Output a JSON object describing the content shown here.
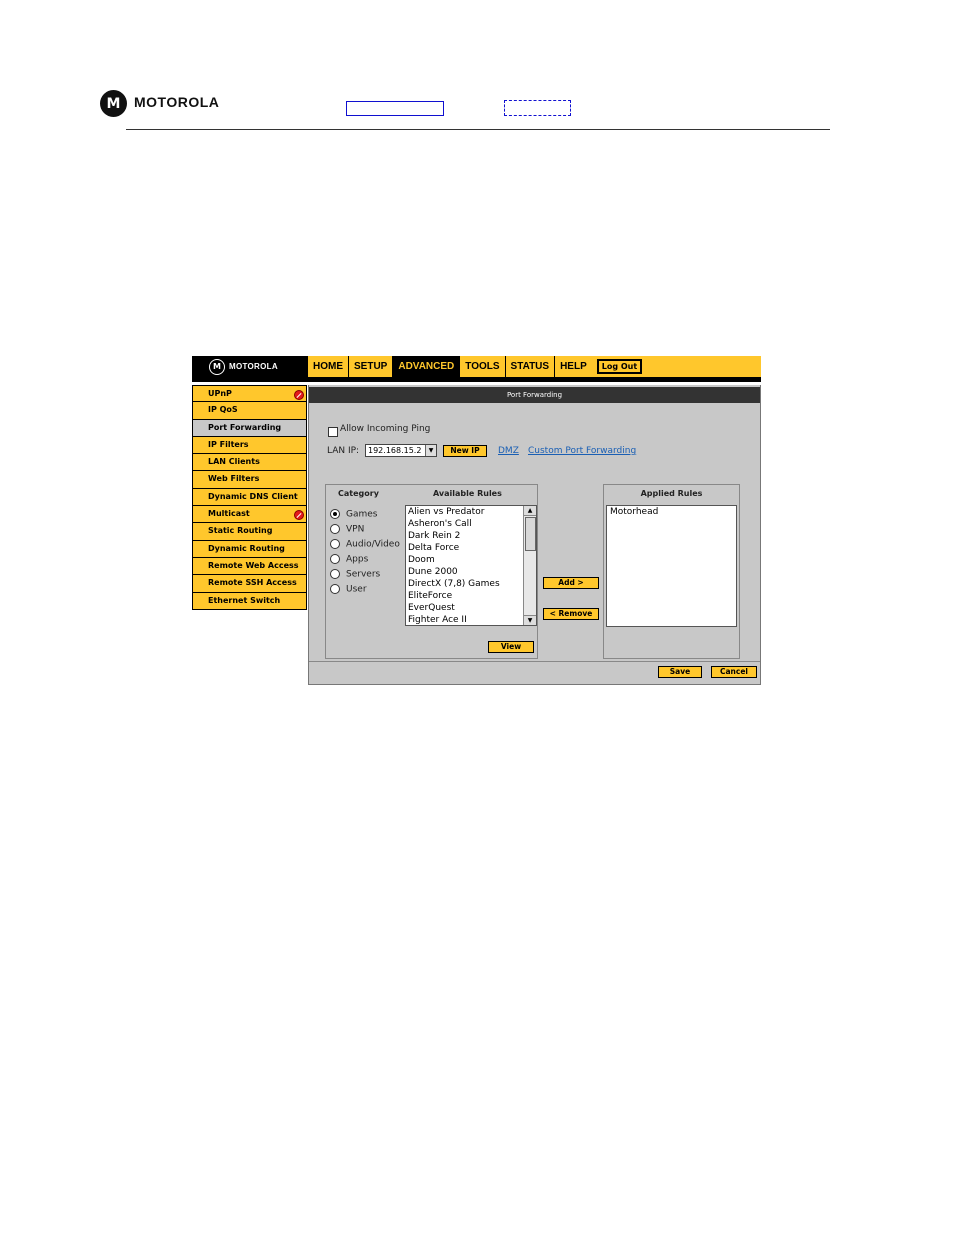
{
  "doc_header": {
    "logo_glyph": "M",
    "brand": "MOTOROLA"
  },
  "app": {
    "logo_glyph": "M",
    "logo_text": "MOTOROLA",
    "nav": [
      "HOME",
      "SETUP",
      "ADVANCED",
      "TOOLS",
      "STATUS",
      "HELP"
    ],
    "nav_active": "ADVANCED",
    "logout_label": "Log Out",
    "sidebar": [
      {
        "label": "UPnP",
        "alert": true
      },
      {
        "label": "IP QoS",
        "alert": false
      },
      {
        "label": "Port Forwarding",
        "alert": false,
        "selected": true
      },
      {
        "label": "IP Filters",
        "alert": false
      },
      {
        "label": "LAN Clients",
        "alert": false
      },
      {
        "label": "Web Filters",
        "alert": false
      },
      {
        "label": "Dynamic DNS Client",
        "alert": false
      },
      {
        "label": "Multicast",
        "alert": true
      },
      {
        "label": "Static Routing",
        "alert": false
      },
      {
        "label": "Dynamic Routing",
        "alert": false
      },
      {
        "label": "Remote Web Access",
        "alert": false
      },
      {
        "label": "Remote SSH Access",
        "alert": false
      },
      {
        "label": "Ethernet Switch",
        "alert": false
      }
    ],
    "page_title": "Port Forwarding",
    "allow_ping_label": "Allow Incoming Ping",
    "allow_ping_checked": false,
    "lan_ip_label": "LAN IP:",
    "lan_ip_value": "192.168.15.2",
    "new_ip_button": "New IP",
    "dmz_link": "DMZ",
    "custom_pf_link": "Custom Port Forwarding",
    "category_header": "Category",
    "available_header": "Available Rules",
    "categories": [
      "Games",
      "VPN",
      "Audio/Video",
      "Apps",
      "Servers",
      "User"
    ],
    "selected_category": "Games",
    "available_rules": [
      "Alien vs Predator",
      "Asheron's Call",
      "Dark Rein 2",
      "Delta Force",
      "Doom",
      "Dune 2000",
      "DirectX (7,8) Games",
      "EliteForce",
      "EverQuest",
      "Fighter Ace II"
    ],
    "view_button": "View",
    "add_button": "Add >",
    "remove_button": "< Remove",
    "applied_header": "Applied Rules",
    "applied_rules": [
      "Motorhead"
    ],
    "save_button": "Save",
    "cancel_button": "Cancel"
  }
}
